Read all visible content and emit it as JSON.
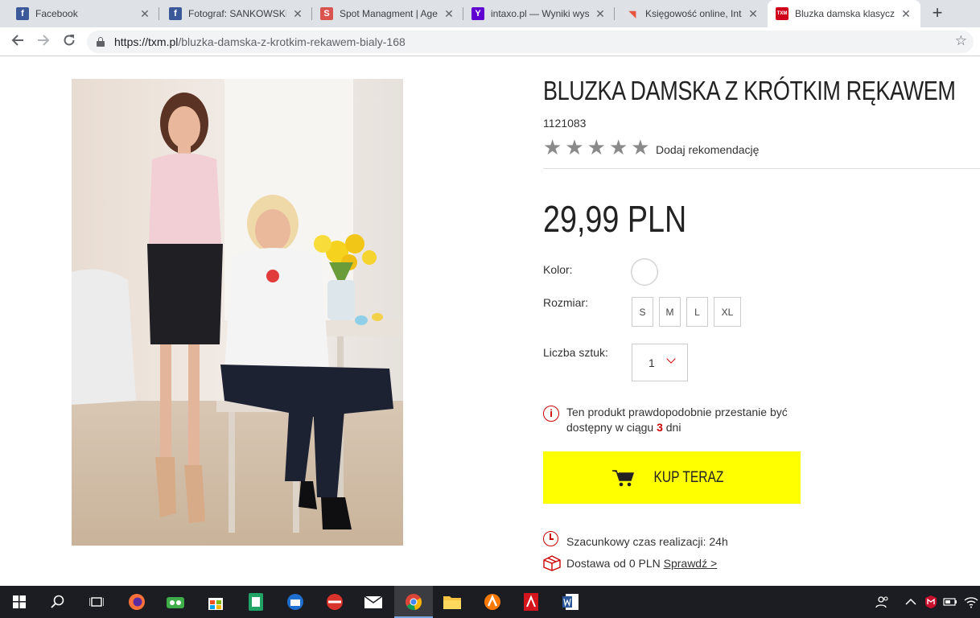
{
  "browser": {
    "tabs": [
      {
        "title": "Facebook",
        "favicon": "facebook-icon",
        "color": "#3b5998",
        "glyph": "f"
      },
      {
        "title": "Fotograf: SANKOWSKI.",
        "favicon": "facebook-icon",
        "color": "#3b5998",
        "glyph": "f"
      },
      {
        "title": "Spot Managment | Age",
        "favicon": "spot-icon",
        "color": "#d9534f",
        "glyph": "S"
      },
      {
        "title": "intaxo.pl — Wyniki wysz",
        "favicon": "yahoo-icon",
        "color": "#5f01d1",
        "glyph": "Y"
      },
      {
        "title": "Księgowość online, Inta",
        "favicon": "intaxo-icon",
        "color": "#e8553e",
        "glyph": "◥"
      },
      {
        "title": "Bluzka damska klasyczn",
        "favicon": "txm-icon",
        "color": "#d0021b",
        "glyph": "TXM",
        "active": true
      }
    ],
    "url_host": "https://txm.pl",
    "url_path": "/bluzka-damska-z-krotkim-rekawem-bialy-168"
  },
  "product": {
    "title": "BLUZKA DAMSKA Z KRÓTKIM RĘKAWEM",
    "sku": "1121083",
    "stars": [
      "★",
      "★",
      "★",
      "★",
      "★"
    ],
    "recommend_label": "Dodaj rekomendację",
    "price": "29,99 PLN",
    "color_label": "Kolor:",
    "selected_color": "#ffffff",
    "size_label": "Rozmiar:",
    "sizes": [
      "S",
      "M",
      "L",
      "XL"
    ],
    "qty_label": "Liczba sztuk:",
    "qty_value": "1",
    "availability_icon": "i",
    "availability_text_before": "Ten produkt prawdopodobnie przestanie być dostępny w ciągu ",
    "availability_days": "3",
    "availability_text_after": " dni",
    "buy_label": "KUP TERAZ",
    "buy_color": "#ffff00",
    "lead_time": "Szacunkowy czas realizacji: 24h",
    "delivery_text": "Dostawa od 0 PLN ",
    "delivery_link": "Sprawdź >"
  }
}
